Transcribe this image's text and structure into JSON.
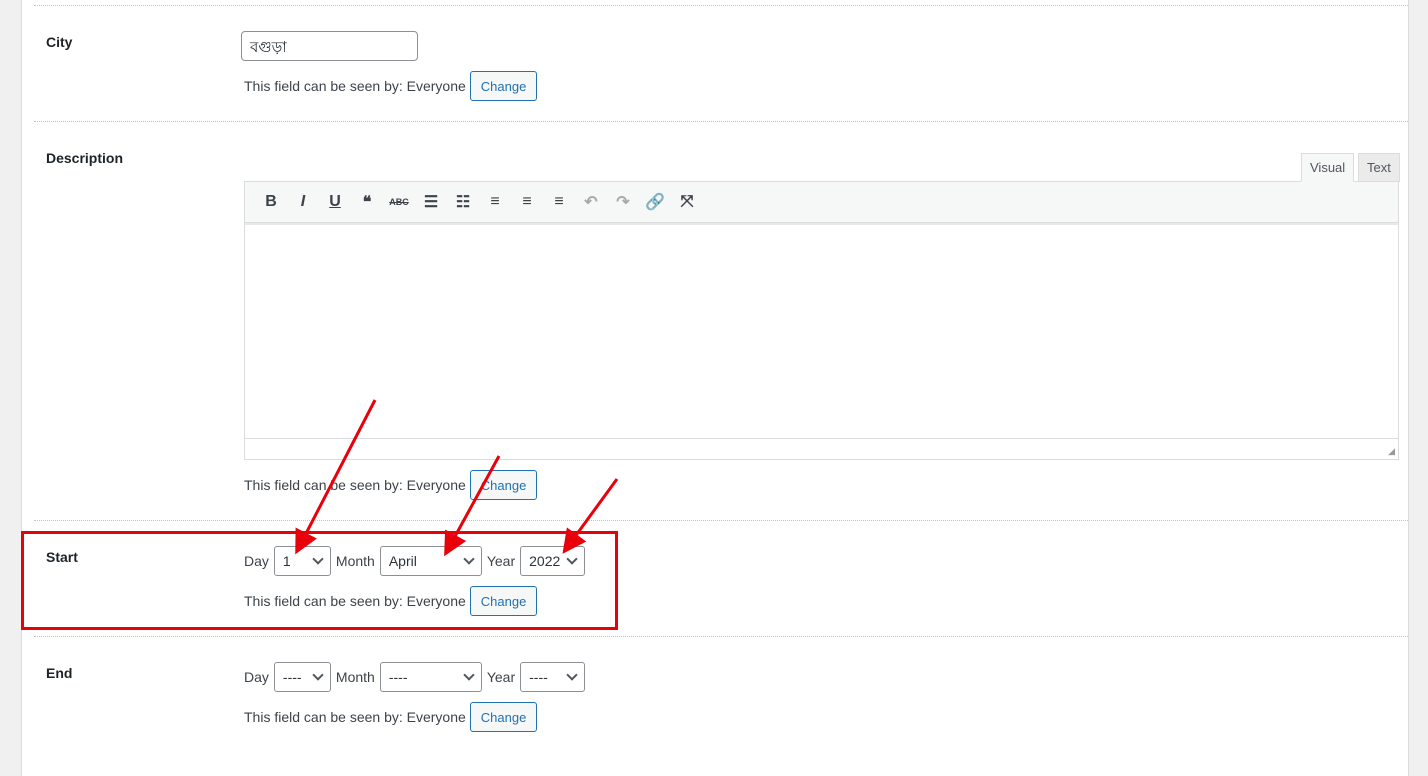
{
  "visibility_text": "This field can be seen by: Everyone",
  "change_label": "Change",
  "city": {
    "label": "City",
    "value": "বগুড়া"
  },
  "description": {
    "label": "Description",
    "tabs": [
      "Visual",
      "Text"
    ],
    "toolbar": [
      "bold-icon",
      "italic-icon",
      "underline-icon",
      "blockquote-icon",
      "strikethrough-icon",
      "bullet-list-icon",
      "numbered-list-icon",
      "align-left-icon",
      "align-center-icon",
      "align-right-icon",
      "undo-icon",
      "redo-icon",
      "link-icon",
      "fullscreen-icon"
    ],
    "toolbar_glyphs": [
      "B",
      "I",
      "U",
      "❝",
      "ABC",
      "☰",
      "☷",
      "≡",
      "≡",
      "≡",
      "↶",
      "↷",
      "🔗",
      "⤧"
    ]
  },
  "start": {
    "label": "Start",
    "day_label": "Day",
    "day": "1",
    "month_label": "Month",
    "month": "April",
    "year_label": "Year",
    "year": "2022"
  },
  "end": {
    "label": "End",
    "day_label": "Day",
    "day": "----",
    "month_label": "Month",
    "month": "----",
    "year_label": "Year",
    "year": "----"
  },
  "annotation_color": "#e8000b"
}
